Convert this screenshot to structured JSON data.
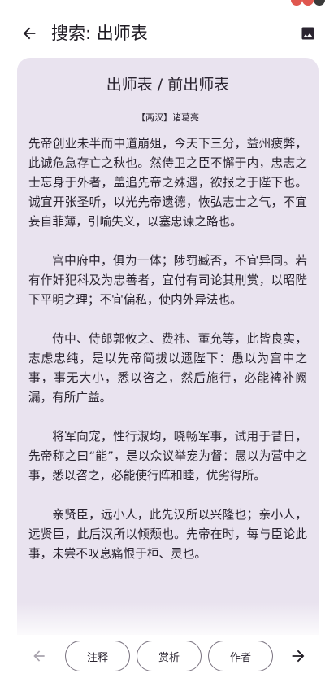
{
  "app_bar": {
    "title": "搜索: 出师表"
  },
  "poem": {
    "title": "出师表 / 前出师表",
    "author": "【两汉】诸葛亮",
    "paragraphs": [
      "先帝创业未半而中道崩殂，今天下三分，益州疲弊，此诚危急存亡之秋也。然侍卫之臣不懈于内，忠志之士忘身于外者，盖追先帝之殊遇，欲报之于陛下也。诚宜开张圣听，以光先帝遗德，恢弘志士之气，不宜妄自菲薄，引喻失义，以塞忠谏之路也。",
      "宫中府中，俱为一体；陟罚臧否，不宜异同。若有作奸犯科及为忠善者，宜付有司论其刑赏，以昭陛下平明之理；不宜偏私，使内外异法也。",
      "侍中、侍郎郭攸之、费祎、董允等，此皆良实，志虑忠纯，是以先帝简拔以遗陛下：愚以为宫中之事，事无大小，悉以咨之，然后施行，必能裨补阙漏，有所广益。",
      "将军向宠，性行淑均，晓畅军事，试用于昔日，先帝称之曰“能”，是以众议举宠为督：愚以为营中之事，悉以咨之，必能使行阵和睦，优劣得所。",
      "亲贤臣，远小人，此先汉所以兴隆也；亲小人，远贤臣，此后汉所以倾颓也。先帝在时，每与臣论此事，未尝不叹息痛恨于桓、灵也。"
    ]
  },
  "bottom_bar": {
    "annotation_label": "注释",
    "appreciation_label": "赏析",
    "author_label": "作者"
  },
  "colors": {
    "card_background": "#e9e3ef",
    "text": "#2a2430",
    "status_dot_red": "#e0574f",
    "status_dot_dark": "#3a3a3a"
  },
  "icons": {
    "back": "arrow-left-icon",
    "image": "image-icon",
    "prev": "arrow-left-icon",
    "next": "arrow-right-icon"
  }
}
